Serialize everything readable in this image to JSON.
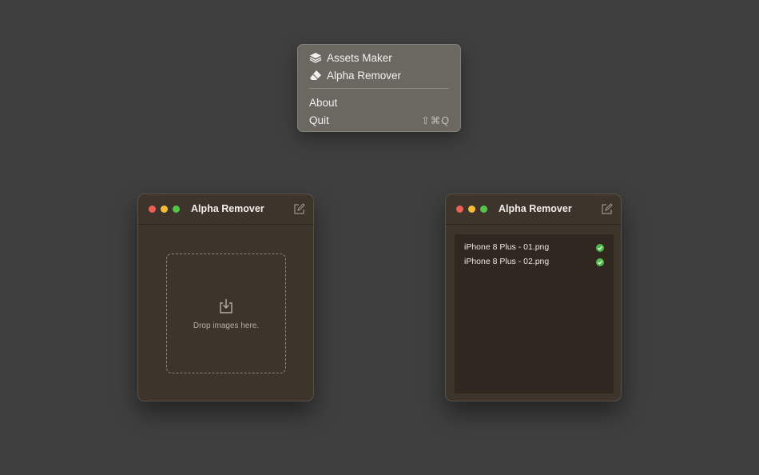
{
  "menu": {
    "items": [
      {
        "label": "Assets Maker",
        "icon": "layers-icon"
      },
      {
        "label": "Alpha Remover",
        "icon": "eraser-icon"
      }
    ],
    "about_label": "About",
    "quit_label": "Quit",
    "quit_shortcut": "⇧⌘Q"
  },
  "window_left": {
    "title": "Alpha Remover",
    "drop_text": "Drop images here."
  },
  "window_right": {
    "title": "Alpha Remover",
    "files": [
      {
        "name": "iPhone 8 Plus - 01.png",
        "status": "done"
      },
      {
        "name": "iPhone 8 Plus - 02.png",
        "status": "done"
      }
    ]
  },
  "colors": {
    "background": "#3f3f3f",
    "window_bg": "#3d342b",
    "check_green": "#4cbb4a",
    "traffic_red": "#ed5f57",
    "traffic_yellow": "#f4bd38",
    "traffic_green": "#56c447"
  }
}
